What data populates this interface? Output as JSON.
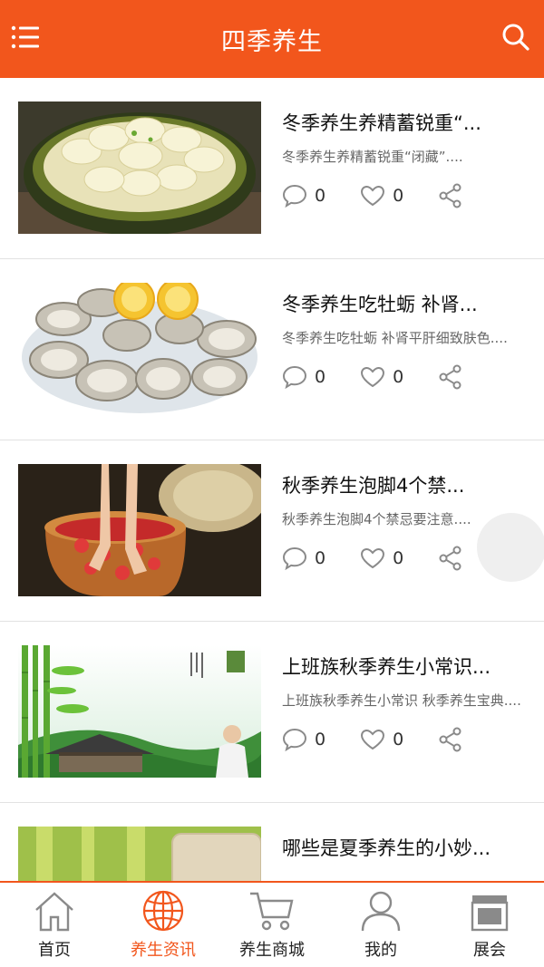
{
  "header": {
    "title": "四季养生",
    "menu_icon": "menu-icon",
    "search_icon": "search-icon"
  },
  "articles": [
    {
      "title": "冬季养生养精蓄锐重“...",
      "desc": "冬季养生养精蓄锐重“闭藏”....",
      "comments": "0",
      "likes": "0",
      "image": "radish-dish"
    },
    {
      "title": "冬季养生吃牡蛎 补肾...",
      "desc": "冬季养生吃牡蛎 补肾平肝细致肤色....",
      "comments": "0",
      "likes": "0",
      "image": "oysters-lemon"
    },
    {
      "title": "秋季养生泡脚4个禁...",
      "desc": "秋季养生泡脚4个禁忌要注意....",
      "comments": "0",
      "likes": "0",
      "image": "foot-bath"
    },
    {
      "title": "上班族秋季养生小常识...",
      "desc": "上班族秋季养生小常识 秋季养生宝典....",
      "comments": "0",
      "likes": "0",
      "image": "bamboo-landscape"
    },
    {
      "title": "哪些是夏季养生的小妙...",
      "desc": "",
      "comments": "",
      "likes": "",
      "image": "bamboo-towel"
    }
  ],
  "tabs": [
    {
      "label": "首页",
      "icon": "home-icon",
      "active": false
    },
    {
      "label": "养生资讯",
      "icon": "globe-icon",
      "active": true
    },
    {
      "label": "养生商城",
      "icon": "cart-icon",
      "active": false
    },
    {
      "label": "我的",
      "icon": "user-icon",
      "active": false
    },
    {
      "label": "展会",
      "icon": "store-icon",
      "active": false
    }
  ],
  "colors": {
    "accent": "#f2561c",
    "icon_gray": "#8a8a8a"
  }
}
